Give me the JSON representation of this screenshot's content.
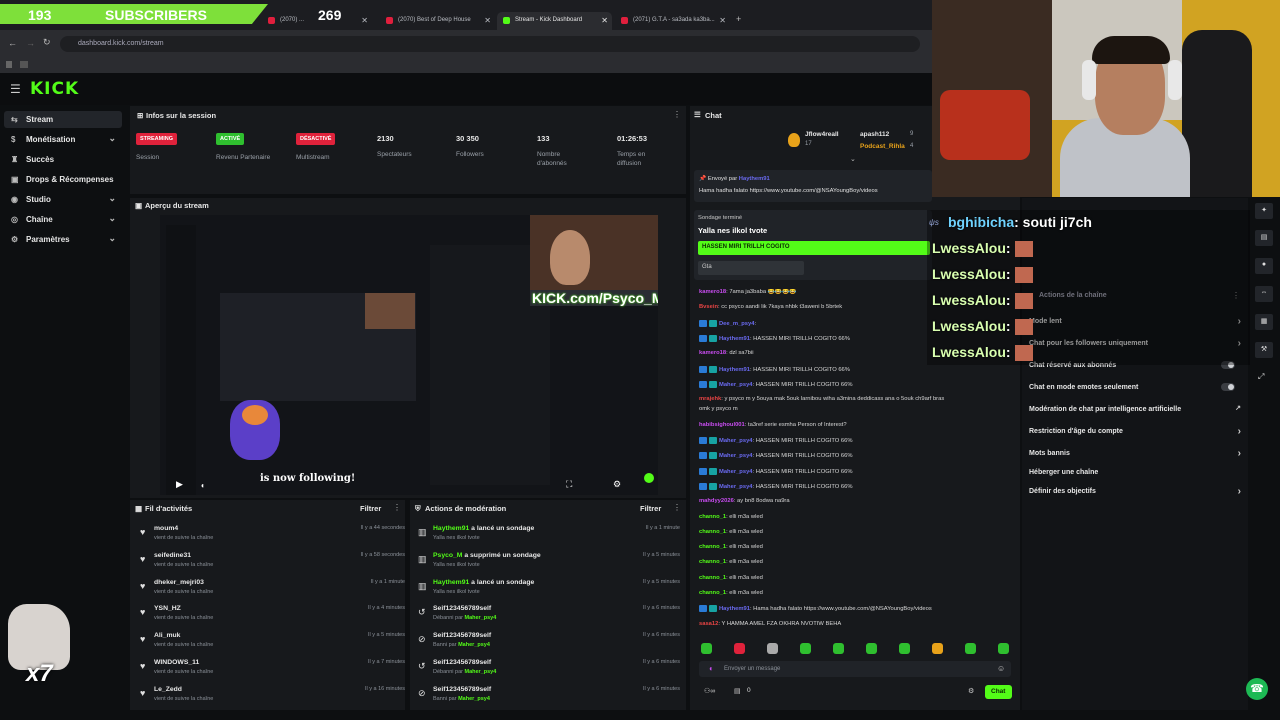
{
  "subs_overlay": {
    "count": "193",
    "label": "SUBSCRIBERS",
    "goal": "269"
  },
  "browser": {
    "tabs": [
      {
        "label": "(2070) Best of Deep House",
        "color": "#e01f3d"
      },
      {
        "label": "Stream - Kick Dashboard",
        "color": "#53fc18"
      },
      {
        "label": "(2071) G.T.A - sa3ada ka3ba...",
        "color": "#e01f3d"
      }
    ],
    "url": "dashboard.kick.com/stream"
  },
  "header": {
    "logo": "KICK"
  },
  "sidebar": {
    "items": [
      {
        "label": "Stream",
        "icon": "stream-icon",
        "active": true
      },
      {
        "label": "Monétisation",
        "icon": "money-icon",
        "chevron": true
      },
      {
        "label": "Succès",
        "icon": "trophy-icon"
      },
      {
        "label": "Drops & Récompenses",
        "icon": "gift-icon"
      },
      {
        "label": "Studio",
        "icon": "studio-icon",
        "chevron": true
      },
      {
        "label": "Chaîne",
        "icon": "channel-icon",
        "chevron": true
      },
      {
        "label": "Paramètres",
        "icon": "gear-icon",
        "chevron": true
      }
    ]
  },
  "session": {
    "title": "Infos sur la session",
    "badges": [
      {
        "text": "STREAMING",
        "label": "Session",
        "color": "#e0223b"
      },
      {
        "text": "ACTIVÉ",
        "label": "Revenu Partenaire",
        "color": "#2fbf2f"
      },
      {
        "text": "DÉSACTIVÉ",
        "label": "Multistream",
        "color": "#e0223b"
      }
    ],
    "stats": [
      {
        "value": "2130",
        "label": "Spectateurs"
      },
      {
        "value": "30 350",
        "label": "Followers"
      },
      {
        "value": "133",
        "label": "Nombre d'abonnés"
      },
      {
        "value": "01:26:53",
        "label": "Temps en diffusion"
      }
    ]
  },
  "preview": {
    "title": "Aperçu du stream",
    "overlay_brand": "KICK.com/Psyco_M",
    "follow_text": "is now following!"
  },
  "activity": {
    "title": "Fil d'activités",
    "filter": "Filtrer",
    "rows": [
      {
        "name": "moum4",
        "sub": "vient de suivre la chaîne",
        "time": "Il y a 44 secondes"
      },
      {
        "name": "seifedine31",
        "sub": "vient de suivre la chaîne",
        "time": "Il y a 58 secondes"
      },
      {
        "name": "dheker_mejri03",
        "sub": "vient de suivre la chaîne",
        "time": "Il y a 1 minute"
      },
      {
        "name": "YSN_HZ",
        "sub": "vient de suivre la chaîne",
        "time": "Il y a 4 minutes"
      },
      {
        "name": "Ali_muk",
        "sub": "vient de suivre la chaîne",
        "time": "Il y a 5 minutes"
      },
      {
        "name": "WINDOWS_11",
        "sub": "vient de suivre la chaîne",
        "time": "Il y a 7 minutes"
      },
      {
        "name": "Le_Zedd",
        "sub": "vient de suivre la chaîne",
        "time": "Il y a 16 minutes"
      }
    ]
  },
  "moderation": {
    "title": "Actions de modération",
    "filter": "Filtrer",
    "rows": [
      {
        "user": "Haythem91",
        "action": " a lancé un sondage",
        "sub": "Yalla nes ilkol tvote",
        "sub_user": "",
        "time": "Il y a 1 minute"
      },
      {
        "user": "Psyco_M",
        "action": " a supprimé un sondage",
        "sub": "Yalla nes ilkol tvote",
        "sub_user": "",
        "time": "Il y a 5 minutes"
      },
      {
        "user": "Haythem91",
        "action": " a lancé un sondage",
        "sub": "Yalla nes ilkol tvote",
        "sub_user": "",
        "time": "Il y a 5 minutes"
      },
      {
        "user": "",
        "action": "Seif123456789self",
        "sub": "Débanni par ",
        "sub_user": "Maher_psy4",
        "time": "Il y a 6 minutes"
      },
      {
        "user": "",
        "action": "Seif123456789self",
        "sub": "Banni par ",
        "sub_user": "Maher_psy4",
        "time": "Il y a 6 minutes"
      },
      {
        "user": "",
        "action": "Seif123456789self",
        "sub": "Débanni par ",
        "sub_user": "Maher_psy4",
        "time": "Il y a 6 minutes"
      },
      {
        "user": "",
        "action": "Seif123456789self",
        "sub": "Banni par ",
        "sub_user": "Maher_psy4",
        "time": "Il y a 6 minutes"
      }
    ]
  },
  "chat": {
    "title": "Chat",
    "pinned": {
      "sent_by": "Envoyé par",
      "user": "Haythem91",
      "text": "Hama hadha falato https://www.youtube.com/@NSAYoungBoy/videos"
    },
    "top_gifters": [
      {
        "name": "Jflow4reall",
        "count": "17"
      },
      {
        "name": "apash112",
        "count": "9"
      },
      {
        "name": "Podcast_Rihla",
        "count": "4"
      }
    ],
    "poll": {
      "status": "Sondage terminé",
      "question": "Yalla nes ilkol tvote",
      "option1": "HASSEN MIRI TRILLH COGITO",
      "option2": "Gta"
    },
    "messages": [
      {
        "user": "kamero18",
        "color": "#c84cf0",
        "text": "7ama ja3baba 😂😂😂😂"
      },
      {
        "user": "Bvsein",
        "color": "#e84444",
        "text": "cc psyco aandi lik 7kaya nhbk t3aweni b 5brtek"
      },
      {
        "user": "Dee_m_psy4",
        "color": "#6a6af0",
        "text": ""
      },
      {
        "user": "Haythem91",
        "color": "#6a6af0",
        "text": "HASSEN MIRI TRILLH COGITO 66%"
      },
      {
        "user": "kamero18",
        "color": "#c84cf0",
        "text": "dzl sa7bii"
      },
      {
        "user": "Haythem91",
        "color": "#6a6af0",
        "text": "HASSEN MIRI TRILLH COGITO 66%"
      },
      {
        "user": "Maher_psy4",
        "color": "#6a6af0",
        "text": "HASSEN MIRI TRILLH COGITO 66%"
      },
      {
        "user": "mrajehk",
        "color": "#e84444",
        "text": "y psyco m y 5ouya mak 5ouk larnibou wiha a3mina deddicass ana o 5ouk ch9arf bras"
      },
      {
        "user": "",
        "color": "#d8d8d8",
        "text": "omk y psyco m"
      },
      {
        "user": "habibsighoul001",
        "color": "#c84cf0",
        "text": "ta3ref serie esmha Person of Interest?"
      },
      {
        "user": "Maher_psy4",
        "color": "#6a6af0",
        "text": "HASSEN MIRI TRILLH COGITO 66%"
      },
      {
        "user": "Maher_psy4",
        "color": "#6a6af0",
        "text": "HASSEN MIRI TRILLH COGITO 66%"
      },
      {
        "user": "Maher_psy4",
        "color": "#6a6af0",
        "text": "HASSEN MIRI TRILLH COGITO 66%"
      },
      {
        "user": "Maher_psy4",
        "color": "#6a6af0",
        "text": "HASSEN MIRI TRILLH COGITO 66%"
      },
      {
        "user": "mahdyy2026",
        "color": "#c84cf0",
        "text": "ay bn8 8odwa na9ra"
      },
      {
        "user": "channo_1",
        "color": "#53fc18",
        "text": "elli m3a wled"
      },
      {
        "user": "channo_1",
        "color": "#53fc18",
        "text": "elli m3a wled"
      },
      {
        "user": "channo_1",
        "color": "#53fc18",
        "text": "elli m3a wled"
      },
      {
        "user": "channo_1",
        "color": "#53fc18",
        "text": "elli m3a wled"
      },
      {
        "user": "channo_1",
        "color": "#53fc18",
        "text": "elli m3a wled"
      },
      {
        "user": "channo_1",
        "color": "#53fc18",
        "text": "elli m3a wled"
      },
      {
        "user": "Haythem91",
        "color": "#6a6af0",
        "text": "Hama hadha falato https://www.youtube.com/@NSAYoungBoy/videos"
      },
      {
        "user": "sasa12",
        "color": "#e84444",
        "text": "Y HAMMA AMEL FZA OKHRA NVOTIW BEHA"
      }
    ],
    "input_placeholder": "Envoyer un message",
    "points": "0",
    "send_label": "Chat"
  },
  "overlay_chat": [
    {
      "user": "bghibicha",
      "text": ": souti ji7ch"
    },
    {
      "user": "LwessAlou",
      "text": ":"
    },
    {
      "user": "LwessAlou",
      "text": ":"
    },
    {
      "user": "LwessAlou",
      "text": ":"
    },
    {
      "user": "LwessAlou",
      "text": ":"
    },
    {
      "user": "LwessAlou",
      "text": ":"
    }
  ],
  "settings": {
    "section": "Actions de la chaîne",
    "items": [
      {
        "label": "Mode lent",
        "control": "chevron"
      },
      {
        "label": "Chat pour les followers uniquement",
        "control": "chevron"
      },
      {
        "label": "Chat réservé aux abonnés",
        "control": "toggle"
      },
      {
        "label": "Chat en mode emotes seulement",
        "control": "toggle"
      },
      {
        "label": "Modération de chat par intelligence artificielle",
        "control": "link"
      },
      {
        "label": "Restriction d'âge du compte",
        "control": "chevron"
      },
      {
        "label": "Mots bannis",
        "control": "chevron"
      },
      {
        "label": "Héberger une chaîne",
        "control": "none"
      },
      {
        "label": "Définir des objectifs",
        "control": "chevron"
      }
    ]
  },
  "corner_overlay": {
    "multiplier": "x7"
  },
  "colors": {
    "accent": "#53fc18",
    "panel": "#17191c",
    "bg": "#0d0f11"
  }
}
